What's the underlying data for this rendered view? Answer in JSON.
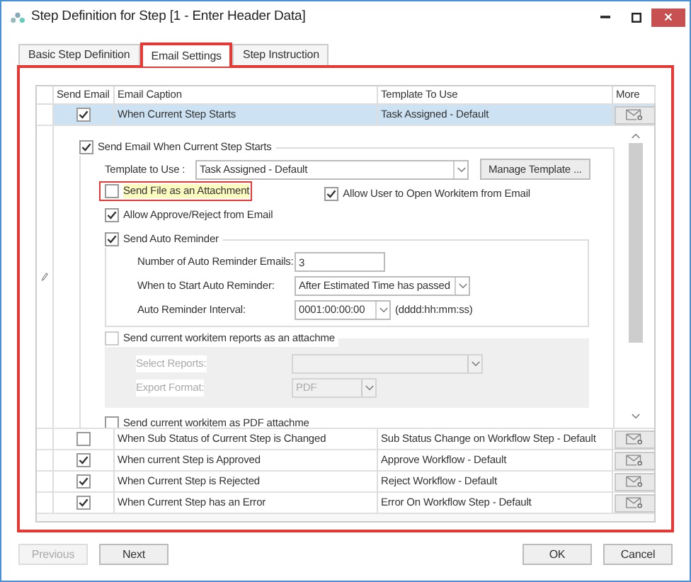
{
  "window": {
    "title": "Step Definition for Step [1 - Enter Header Data]"
  },
  "tabs": [
    {
      "label": "Basic Step Definition",
      "selected": false
    },
    {
      "label": "Email Settings",
      "selected": true
    },
    {
      "label": "Step Instruction",
      "selected": false
    }
  ],
  "grid": {
    "columns": [
      "Send Email",
      "Email Caption",
      "Template To Use",
      "More"
    ],
    "rows": [
      {
        "send_email": true,
        "caption": "When Current Step Starts",
        "template": "Task Assigned - Default",
        "selected": true,
        "expanded": true
      },
      {
        "send_email": false,
        "caption": "When Sub Status of Current Step is Changed",
        "template": "Sub Status Change on Workflow Step - Default",
        "selected": false,
        "expanded": false
      },
      {
        "send_email": true,
        "caption": "When current Step is Approved",
        "template": "Approve Workflow - Default",
        "selected": false,
        "expanded": false
      },
      {
        "send_email": true,
        "caption": "When Current Step is Rejected",
        "template": "Reject Workflow - Default",
        "selected": false,
        "expanded": false
      },
      {
        "send_email": true,
        "caption": "When Current Step has an Error",
        "template": "Error On Workflow Step - Default",
        "selected": false,
        "expanded": false
      }
    ]
  },
  "detail": {
    "send_email": {
      "label": "Send Email When Current Step Starts",
      "checked": true
    },
    "template_label": "Template to Use :",
    "template_value": "Task Assigned - Default",
    "manage_button": "Manage Template ...",
    "send_file": {
      "label": "Send File as an Attachment",
      "checked": false,
      "highlighted": true
    },
    "allow_open": {
      "label": "Allow User to Open Workitem from Email",
      "checked": true
    },
    "allow_approve": {
      "label": "Allow Approve/Reject from Email",
      "checked": true
    },
    "auto_reminder": {
      "label": "Send Auto Reminder",
      "checked": true,
      "count_label": "Number of Auto Reminder Emails:",
      "count_value": "3",
      "start_label": "When to Start Auto Reminder:",
      "start_value": "After Estimated Time has passed",
      "interval_label": "Auto Reminder Interval:",
      "interval_value": "0001:00:00:00",
      "interval_hint": "(dddd:hh:mm:ss)"
    },
    "reports": {
      "label": "Send current workitem reports as an attachme",
      "checked": false,
      "disabled": true,
      "select_label": "Select Reports:",
      "format_label": "Export Format:",
      "format_value": "PDF"
    },
    "pdf": {
      "label": "Send current workitem as PDF attachme",
      "checked": false
    }
  },
  "footer": {
    "previous": {
      "label": "Previous",
      "disabled": true
    },
    "next": {
      "label": "Next",
      "disabled": false
    },
    "ok": "OK",
    "cancel": "Cancel"
  }
}
